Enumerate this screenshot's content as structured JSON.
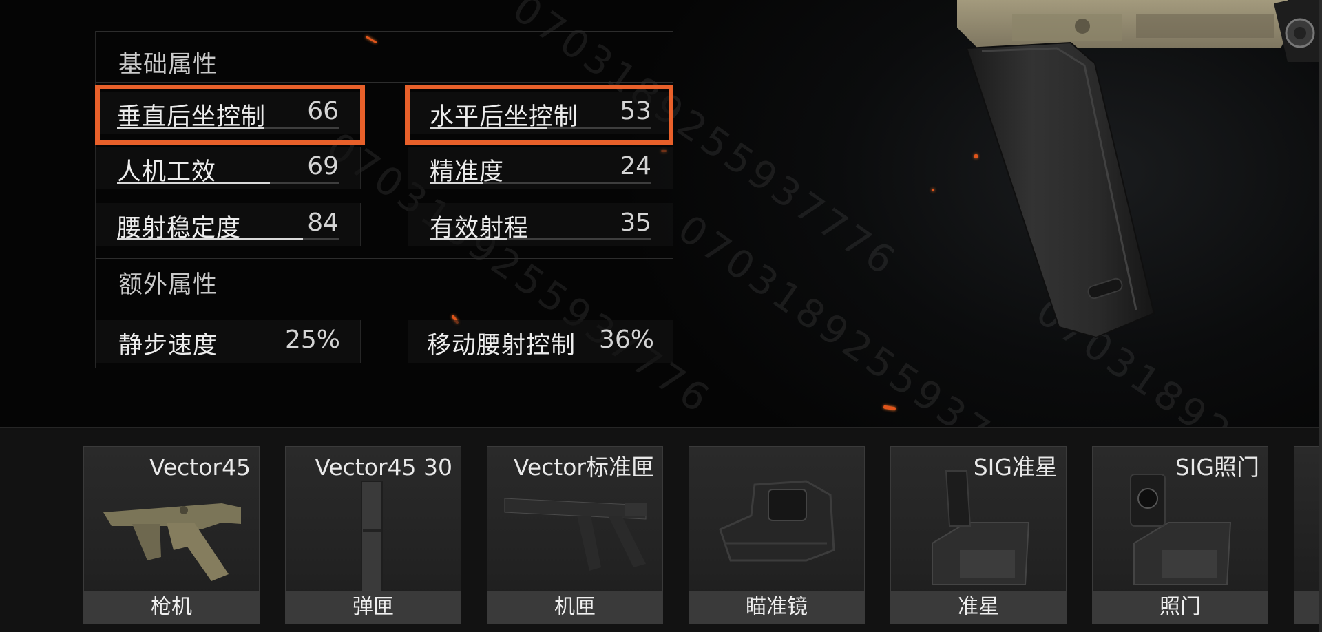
{
  "stats": {
    "basic_title": "基础属性",
    "extra_title": "额外属性",
    "basic": [
      {
        "label": "垂直后坐控制",
        "value": "66",
        "level": 0.66,
        "highlighted": true
      },
      {
        "label": "水平后坐控制",
        "value": "53",
        "level": 0.53,
        "highlighted": true
      },
      {
        "label": "人机工效",
        "value": "69",
        "level": 0.69,
        "highlighted": false
      },
      {
        "label": "精准度",
        "value": "24",
        "level": 0.24,
        "highlighted": false
      },
      {
        "label": "腰射稳定度",
        "value": "84",
        "level": 0.84,
        "highlighted": false
      },
      {
        "label": "有效射程",
        "value": "35",
        "level": 0.35,
        "highlighted": false
      }
    ],
    "extra": [
      {
        "label": "静步速度",
        "value": "25%"
      },
      {
        "label": "移动腰射控制",
        "value": "36%"
      }
    ]
  },
  "attachments": [
    {
      "name": "Vector45",
      "type": "枪机",
      "icon": "receiver-icon"
    },
    {
      "name": "Vector45 30",
      "type": "弹匣",
      "icon": "magazine-icon"
    },
    {
      "name": "Vector标准匣",
      "type": "机匣",
      "icon": "stock-icon"
    },
    {
      "name": "",
      "type": "瞄准镜",
      "icon": "scope-icon"
    },
    {
      "name": "SIG准星",
      "type": "准星",
      "icon": "front-sight-icon"
    },
    {
      "name": "SIG照门",
      "type": "照门",
      "icon": "rear-sight-icon"
    }
  ],
  "watermark": "0703189255937776",
  "colors": {
    "highlight": "#e8602a",
    "ember": "#e0541b"
  }
}
